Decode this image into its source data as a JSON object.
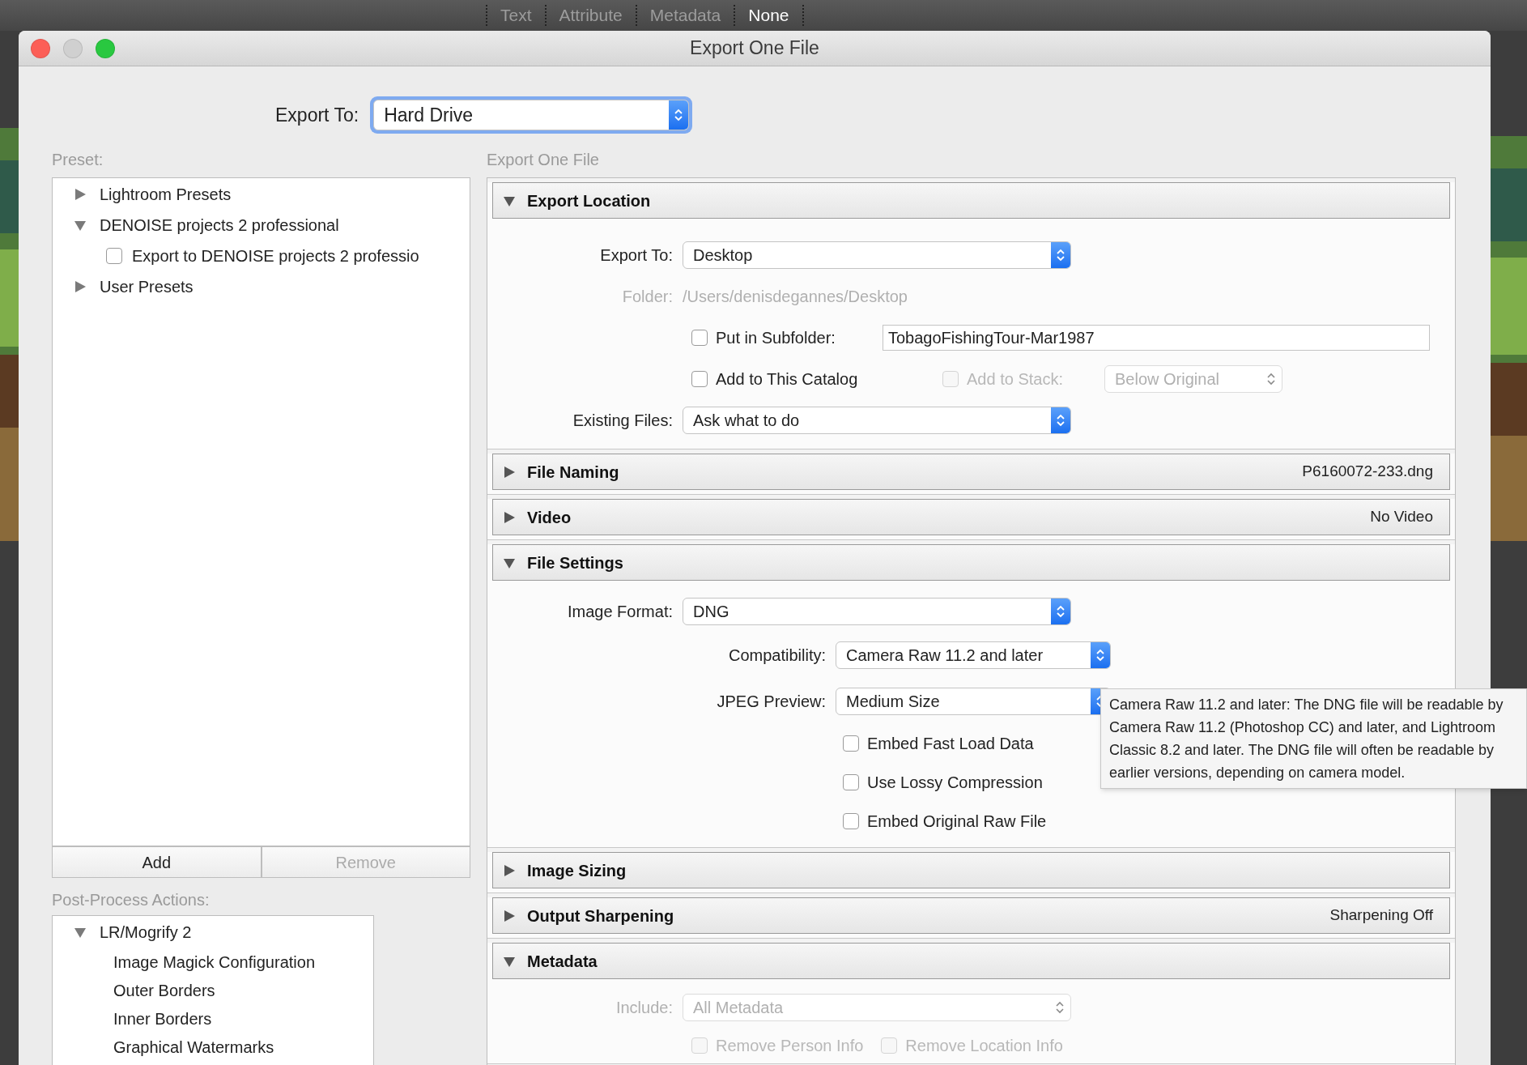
{
  "filter_bar": {
    "items": [
      {
        "label": "Text",
        "selected": false
      },
      {
        "label": "Attribute",
        "selected": false
      },
      {
        "label": "Metadata",
        "selected": false
      },
      {
        "label": "None",
        "selected": true
      }
    ]
  },
  "window": {
    "title": "Export One File",
    "controls": [
      {
        "kind": "close",
        "disabled": false
      },
      {
        "kind": "minimize",
        "disabled": true
      },
      {
        "kind": "zoom",
        "disabled": false
      }
    ]
  },
  "export_to": {
    "label": "Export To:",
    "value": "Hard Drive",
    "focused": true
  },
  "preset_panel": {
    "label": "Preset:",
    "tree": [
      {
        "label": "Lightroom Presets",
        "expanded": false
      },
      {
        "label": "DENOISE projects 2 professional",
        "expanded": true,
        "children": [
          {
            "label": "Export to DENOISE projects 2 professio",
            "checked": false
          }
        ]
      },
      {
        "label": "User Presets",
        "expanded": false
      }
    ],
    "buttons": [
      {
        "label": "Add",
        "disabled": false
      },
      {
        "label": "Remove",
        "disabled": true
      }
    ]
  },
  "post_process": {
    "label": "Post-Process Actions:",
    "tree": [
      {
        "label": "LR/Mogrify 2",
        "expanded": true,
        "children": [
          {
            "label": "Image Magick Configuration"
          },
          {
            "label": "Outer Borders"
          },
          {
            "label": "Inner Borders"
          },
          {
            "label": "Graphical Watermarks"
          }
        ]
      }
    ]
  },
  "settings": {
    "label": "Export One File",
    "sections": [
      {
        "title": "Export Location",
        "expanded": true,
        "rows": [
          {
            "kind": "select",
            "label": "Export To:",
            "value": "Desktop",
            "disabled": false
          },
          {
            "kind": "path",
            "label": "Folder:",
            "value": "/Users/denisdegannes/Desktop"
          },
          {
            "kind": "checkbox_field",
            "label": "Put in Subfolder:",
            "checked": false,
            "value": "TobagoFishingTour-Mar1987"
          },
          {
            "kind": "checkbox_stack",
            "label": "Add to This Catalog",
            "checked": false,
            "stack": {
              "label": "Add to Stack:",
              "checked": false,
              "disabled": true,
              "value": "Below Original"
            }
          },
          {
            "kind": "select",
            "label": "Existing Files:",
            "value": "Ask what to do",
            "disabled": false
          }
        ]
      },
      {
        "title": "File Naming",
        "expanded": false,
        "summary": "P6160072-233.dng"
      },
      {
        "title": "Video",
        "expanded": false,
        "summary": "No Video"
      },
      {
        "title": "File Settings",
        "expanded": true,
        "rows": [
          {
            "kind": "select",
            "label": "Image Format:",
            "value": "DNG",
            "disabled": false
          },
          {
            "kind": "subselect",
            "label": "Compatibility:",
            "value": "Camera Raw 11.2 and later"
          },
          {
            "kind": "subselect",
            "label": "JPEG Preview:",
            "value": "Medium Size"
          },
          {
            "kind": "checkbox",
            "label": "Embed Fast Load Data",
            "checked": false
          },
          {
            "kind": "checkbox",
            "label": "Use Lossy Compression",
            "checked": false
          },
          {
            "kind": "checkbox",
            "label": "Embed Original Raw File",
            "checked": false
          }
        ]
      },
      {
        "title": "Image Sizing",
        "expanded": false
      },
      {
        "title": "Output Sharpening",
        "expanded": false,
        "summary": "Sharpening Off"
      },
      {
        "title": "Metadata",
        "expanded": true,
        "rows": [
          {
            "kind": "select",
            "label": "Include:",
            "value": "All Metadata",
            "disabled": true
          },
          {
            "kind": "checkbox_pair",
            "items": [
              {
                "label": "Remove Person Info",
                "checked": false,
                "disabled": true
              },
              {
                "label": "Remove Location Info",
                "checked": false,
                "disabled": true
              }
            ]
          }
        ]
      }
    ]
  },
  "tooltip": {
    "text": "Camera Raw 11.2 and later: The DNG file will be readable by Camera Raw 11.2 (Photoshop CC) and later, and Lightroom Classic 8.2 and later. The DNG file will often be readable by earlier versions, depending on camera model."
  }
}
